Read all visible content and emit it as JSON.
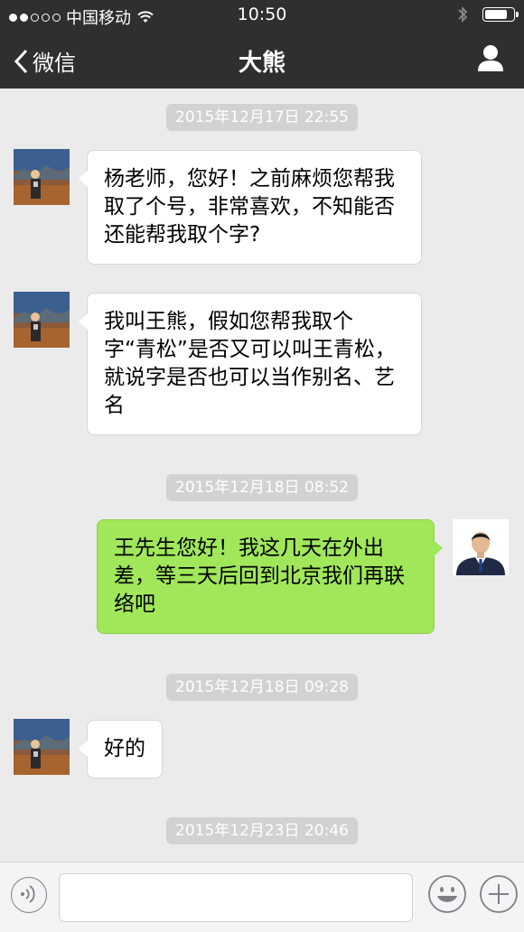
{
  "status_bar": {
    "carrier": "中国移动",
    "time": "10:50",
    "signal_filled": 2,
    "signal_total": 5,
    "battery_level": 0.85
  },
  "nav": {
    "back_label": "微信",
    "title": "大熊"
  },
  "messages": [
    {
      "type": "timestamp",
      "text": "2015年12月17日 22:55"
    },
    {
      "type": "incoming",
      "text": "杨老师，您好！之前麻烦您帮我取了个号，非常喜欢，不知能否还能帮我取个字?"
    },
    {
      "type": "incoming",
      "text": "我叫王熊，假如您帮我取个字“青松”是否又可以叫王青松，就说字是否也可以当作别名、艺名"
    },
    {
      "type": "timestamp",
      "text": "2015年12月18日 08:52"
    },
    {
      "type": "outgoing",
      "text": "王先生您好！我这几天在外出差，等三天后回到北京我们再联络吧"
    },
    {
      "type": "timestamp",
      "text": "2015年12月18日 09:28"
    },
    {
      "type": "incoming",
      "text": "好的"
    },
    {
      "type": "timestamp",
      "text": "2015年12月23日 20:46"
    }
  ],
  "input": {
    "value": "",
    "placeholder": ""
  },
  "icons": {
    "back": "chevron-left-icon",
    "profile": "person-icon",
    "voice": "voice-icon",
    "emoji": "emoji-icon",
    "plus": "plus-icon"
  },
  "colors": {
    "bar": "#2f2f30",
    "chat_bg": "#ebebeb",
    "outgoing_bubble": "#a0e75a",
    "incoming_bubble": "#ffffff",
    "timestamp_bg": "#d2d2d2"
  }
}
